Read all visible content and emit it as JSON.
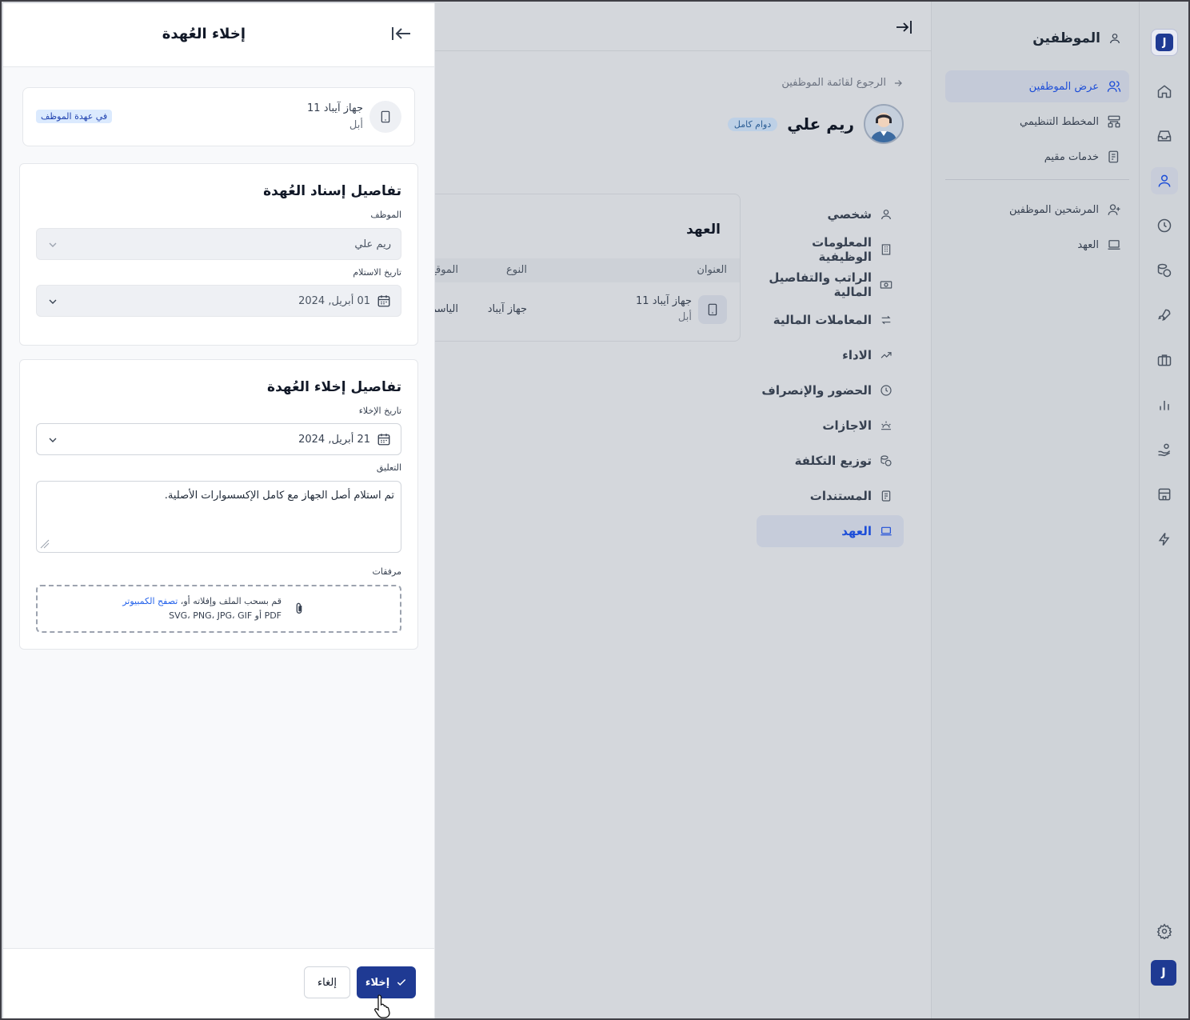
{
  "app": {
    "logo_letter": "J"
  },
  "rail": {
    "icons": [
      "home-icon",
      "inbox-icon",
      "user-icon",
      "clock-icon",
      "coins-icon",
      "rocket-icon",
      "briefcase-icon",
      "bar-chart-icon",
      "hand-coin-icon",
      "store-icon",
      "lightning-icon"
    ],
    "active": "user-icon",
    "settings_icon": "gear-icon",
    "account_letter": "J"
  },
  "sidebar": {
    "title": "الموظفين",
    "items": [
      {
        "label": "عرض الموظفين",
        "icon": "users-icon",
        "active": true
      },
      {
        "label": "المخطط التنظيمي",
        "icon": "org-chart-icon"
      },
      {
        "label": "خدمات مقيم",
        "icon": "document-icon"
      },
      {
        "label": "المرشحين الموظفين",
        "icon": "user-plus-icon"
      },
      {
        "label": "العهد",
        "icon": "laptop-icon"
      }
    ]
  },
  "employee": {
    "back_label": "الرجوع لقائمة الموظفين",
    "name": "ريم علي",
    "badge": "دوام كامل",
    "menu": [
      {
        "label": "شخصي",
        "icon": "person-icon"
      },
      {
        "label": "المعلومات الوظيفية",
        "icon": "building-icon"
      },
      {
        "label": "الراتب والتفاصيل المالية",
        "icon": "money-icon"
      },
      {
        "label": "المعاملات المالية",
        "icon": "transfer-icon"
      },
      {
        "label": "الاداء",
        "icon": "trend-icon"
      },
      {
        "label": "الحضور والإنصراف",
        "icon": "clock-icon"
      },
      {
        "label": "الاجازات",
        "icon": "sun-icon"
      },
      {
        "label": "توزيع التكلفة",
        "icon": "coins-icon"
      },
      {
        "label": "المستندات",
        "icon": "document-icon"
      },
      {
        "label": "العهد",
        "icon": "laptop-icon",
        "active": true
      }
    ],
    "assets_card": {
      "title": "العهد",
      "columns": [
        "العنوان",
        "النوع",
        "الموقع"
      ],
      "row": {
        "name": "جهاز آيباد 11",
        "brand": "أبل",
        "type": "جهاز آيباد",
        "location": "الياسم"
      }
    }
  },
  "drawer": {
    "title": "إخلاء العُهدة",
    "asset": {
      "name": "جهاز آيباد 11",
      "brand": "أبل",
      "badge": "في عهدة الموظف"
    },
    "assign_section": {
      "title": "تفاصيل إسناد العُهدة",
      "employee_label": "الموظف",
      "employee_value": "ريم علي",
      "received_label": "تاريخ الاستلام",
      "received_value": "01 أبريل, 2024"
    },
    "release_section": {
      "title": "تفاصيل إخلاء العُهدة",
      "release_date_label": "تاريخ الإخلاء",
      "release_date_value": "21 أبريل, 2024",
      "comment_label": "التعليق",
      "comment_value": "تم استلام أصل الجهاز مع كامل الإكسسوارات الأصلية.",
      "attachments_label": "مرفقات",
      "drop_text": "قم بسحب الملف وإفلاته أو، ",
      "drop_link": "تصفح الكمبيوتر",
      "drop_formats": "PDF أو SVG، PNG، JPG، GIF"
    },
    "footer": {
      "confirm_label": "إخلاء",
      "cancel_label": "إلغاء"
    }
  }
}
